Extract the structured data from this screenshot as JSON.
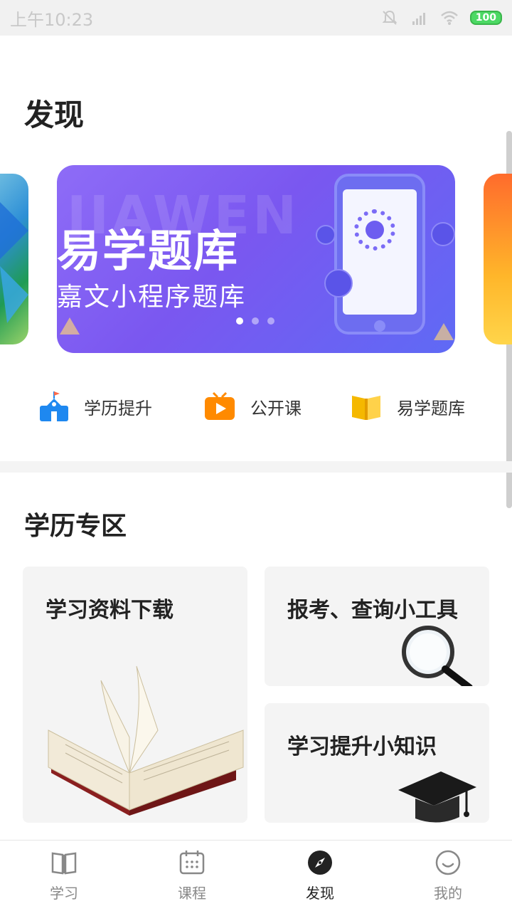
{
  "status_bar": {
    "time": "上午10:23",
    "battery": "100"
  },
  "page_title": "发现",
  "carousel": {
    "bg_word": "JIAWEN",
    "title": "易学题库",
    "subtitle": "嘉文小程序题库",
    "active_dot": 0,
    "dot_count": 3
  },
  "quick_entries": [
    {
      "label": "学历提升",
      "icon": "school-icon",
      "color": "#1e88f0"
    },
    {
      "label": "公开课",
      "icon": "tv-play-icon",
      "color": "#ff8a00"
    },
    {
      "label": "易学题库",
      "icon": "book-icon",
      "color": "#f5b800"
    }
  ],
  "section": {
    "title": "学历专区"
  },
  "cards": {
    "download": {
      "title": "学习资料下载",
      "icon": "open-book-icon"
    },
    "tools": {
      "title": "报考、查询小工具",
      "icon": "magnifier-icon"
    },
    "knowledge": {
      "title": "学习提升小知识",
      "icon": "graduation-cap-icon"
    }
  },
  "bottom_nav": {
    "items": [
      {
        "label": "学习",
        "icon": "book-outline-icon"
      },
      {
        "label": "课程",
        "icon": "calendar-icon"
      },
      {
        "label": "发现",
        "icon": "compass-icon"
      },
      {
        "label": "我的",
        "icon": "smile-icon"
      }
    ],
    "active_index": 2
  },
  "colors": {
    "banner_start": "#8e6cf7",
    "banner_end": "#5f6af5",
    "card_bg": "#f4f4f4",
    "nav_active": "#222222",
    "nav_inactive": "#888888"
  }
}
